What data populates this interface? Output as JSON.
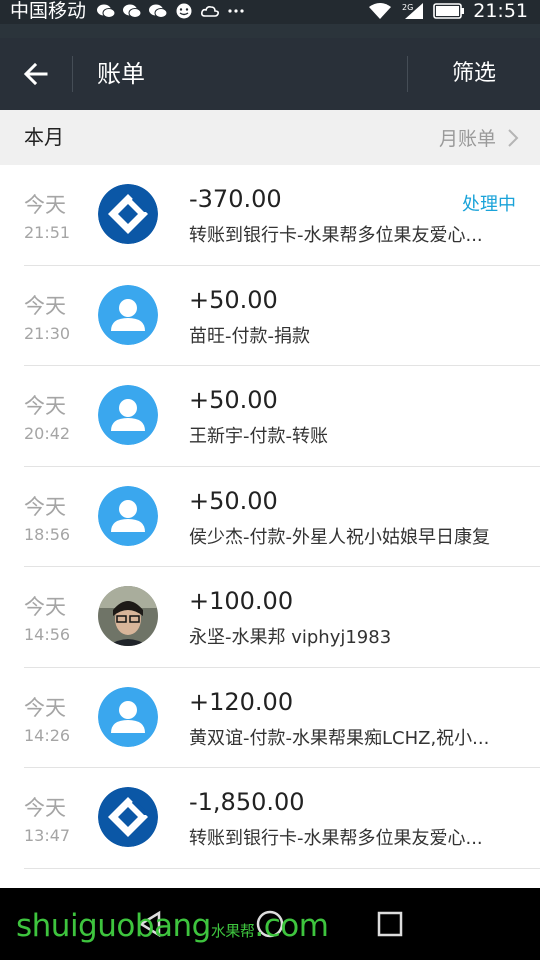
{
  "status_bar": {
    "carrier": "中国移动",
    "time": "21:51",
    "icons": [
      "wechat-icon",
      "wechat-icon",
      "wechat-icon",
      "smiley-icon",
      "cloud-icon",
      "more-dots-icon"
    ],
    "right_icons": [
      "wifi-icon",
      "signal-icon",
      "battery-icon"
    ],
    "signal_label": "2G"
  },
  "header": {
    "title": "账单",
    "filter_label": "筛选"
  },
  "month_section": {
    "label": "本月",
    "monthly_bill_label": "月账单"
  },
  "transactions": [
    {
      "day": "今天",
      "time": "21:51",
      "amount": "-370.00",
      "description": "转账到银行卡-水果帮多位果友爱心...",
      "status": "处理中",
      "avatar": "bank"
    },
    {
      "day": "今天",
      "time": "21:30",
      "amount": "+50.00",
      "description": "苗旺-付款-捐款",
      "status": "",
      "avatar": "user"
    },
    {
      "day": "今天",
      "time": "20:42",
      "amount": "+50.00",
      "description": "王新宇-付款-转账",
      "status": "",
      "avatar": "user"
    },
    {
      "day": "今天",
      "time": "18:56",
      "amount": "+50.00",
      "description": "侯少杰-付款-外星人祝小姑娘早日康复",
      "status": "",
      "avatar": "user"
    },
    {
      "day": "今天",
      "time": "14:56",
      "amount": "+100.00",
      "description": "永坚-水果邦    viphyj1983",
      "status": "",
      "avatar": "photo"
    },
    {
      "day": "今天",
      "time": "14:26",
      "amount": "+120.00",
      "description": "黄双谊-付款-水果帮果痴LCHZ,祝小...",
      "status": "",
      "avatar": "user"
    },
    {
      "day": "今天",
      "time": "13:47",
      "amount": "-1,850.00",
      "description": "转账到银行卡-水果帮多位果友爱心...",
      "status": "",
      "avatar": "bank"
    }
  ],
  "watermark": {
    "text": "shuiguobang",
    "suffix": ".com",
    "cn": "水果帮"
  },
  "colors": {
    "header_bg": "#293039",
    "status_accent": "#1aa3d9",
    "user_avatar": "#3aa7ee",
    "bank_logo": "#0b57a6",
    "watermark": "#3ec43e"
  }
}
